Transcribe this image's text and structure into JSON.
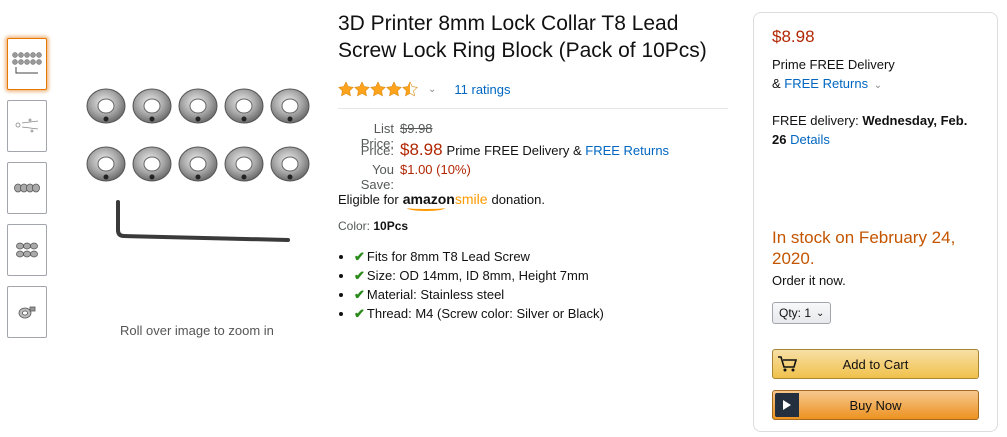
{
  "product": {
    "title": "3D Printer 8mm Lock Collar T8 Lead Screw Lock Ring Block (Pack of 10Pcs)",
    "rating": 4.5,
    "ratings_count": "11 ratings"
  },
  "pricing": {
    "list_label": "List Price:",
    "list_price": "$9.98",
    "price_label": "Price:",
    "price": "$8.98",
    "prime_text": "Prime FREE Delivery &",
    "free_returns": "FREE Returns",
    "save_label": "You Save:",
    "save_value": "$1.00 (10%)"
  },
  "smile": {
    "prefix": "Eligible for",
    "logo_main": "amazon",
    "logo_accent": "smile",
    "suffix": "donation."
  },
  "color": {
    "label": "Color:",
    "value": "10Pcs"
  },
  "bullets": [
    "Fits for 8mm T8 Lead Screw",
    "Size: OD 14mm, ID 8mm, Height 7mm",
    "Material: Stainless steel",
    "Thread: M4 (Screw color: Silver or Black)"
  ],
  "gallery": {
    "zoom_hint": "Roll over image to zoom in",
    "thumbnail_count": 5
  },
  "buybox": {
    "price": "$8.98",
    "prime_line": "Prime FREE Delivery",
    "returns_prefix": "&",
    "returns": "FREE Returns",
    "delivery_prefix": "FREE delivery:",
    "delivery_date": "Wednesday, Feb. 26",
    "details": "Details",
    "stock": "In stock on February 24, 2020.",
    "order_now": "Order it now.",
    "qty_label": "Qty:",
    "qty_value": "1",
    "add_to_cart": "Add to Cart",
    "buy_now": "Buy Now"
  },
  "colors": {
    "price_red": "#b12704",
    "link_blue": "#0066c0",
    "stock_orange": "#c45500",
    "cart_button": "#f0c14b",
    "buy_button": "#ed9220"
  }
}
